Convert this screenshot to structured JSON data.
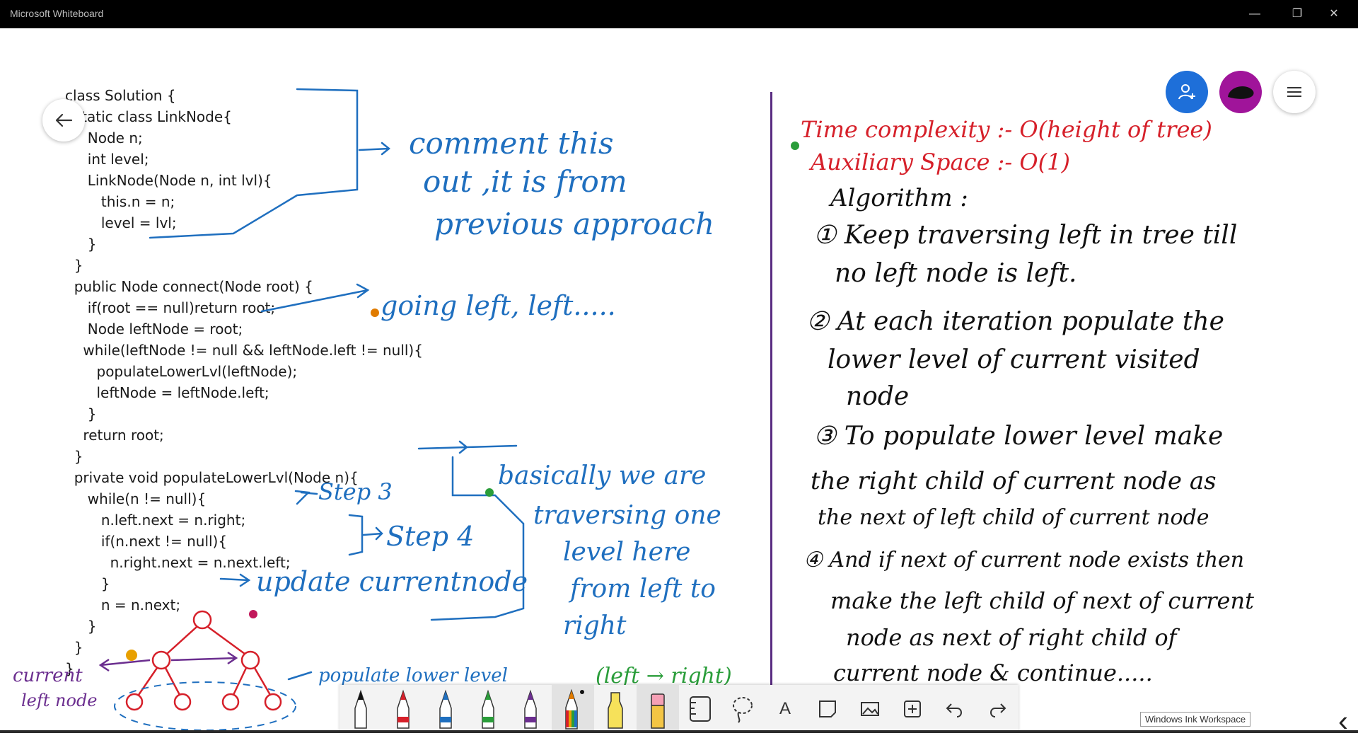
{
  "window": {
    "title": "Microsoft Whiteboard",
    "controls": [
      "—",
      "❐",
      "✕"
    ]
  },
  "code": [
    "class Solution {",
    "  static class LinkNode{",
    "     Node n;",
    "     int level;",
    "     LinkNode(Node n, int lvl){",
    "        this.n = n;",
    "        level = lvl;",
    "     }",
    "  }",
    "  public Node connect(Node root) {",
    "     if(root == null)return root;",
    "     Node leftNode = root;",
    "    while(leftNode != null && leftNode.left != null){",
    "       populateLowerLvl(leftNode);",
    "       leftNode = leftNode.left;",
    "     }",
    "    return root;",
    "  }",
    "  private void populateLowerLvl(Node n){",
    "     while(n != null){",
    "        n.left.next = n.right;",
    "        if(n.next != null){",
    "          n.right.next = n.next.left;",
    "        }",
    "        n = n.next;",
    "     }",
    "  }",
    "}"
  ],
  "annotations": {
    "comment": [
      "comment this",
      "out ,it is from",
      "previous approach"
    ],
    "going_left": "going left, left.....",
    "step3": "Step 3",
    "step4": "Step 4",
    "update": "update currentnode",
    "basically": [
      "basically we are",
      "traversing one",
      "level here",
      "from left to",
      "right"
    ],
    "current_left": [
      "current",
      "left node"
    ],
    "populate_lower": "populate lower level",
    "left_right": "(left → right)"
  },
  "notes": {
    "time_complexity": "Time complexity :- O(height of tree)",
    "aux_space": "Auxiliary Space :- O(1)",
    "algorithm": "Algorithm :",
    "steps": [
      [
        "① Keep traversing left in tree till",
        "no left node is left."
      ],
      [
        "② At each iteration populate the",
        "lower level of current visited",
        "node"
      ],
      [
        "③ To populate lower level make",
        "the right child of current node as",
        "the next of left child of current node"
      ],
      [
        "④ And if next of current node exists then",
        "make the left child of next of current",
        "node as next of right child of",
        "current node & continue....."
      ]
    ]
  },
  "toolbar": {
    "tools": [
      "black-pen",
      "red-pen",
      "blue-pen",
      "green-pen",
      "purple-pen",
      "rainbow-pen",
      "yellow-highlighter",
      "eraser",
      "ruler",
      "lasso",
      "text",
      "sticky-note",
      "image",
      "add",
      "undo",
      "redo"
    ],
    "text_label": "A"
  },
  "ink_workspace_label": "Windows Ink Workspace",
  "colors": {
    "accent_blue": "#1e6fd9",
    "avatar_magenta": "#a0149a",
    "divider_purple": "#5a2d82"
  }
}
